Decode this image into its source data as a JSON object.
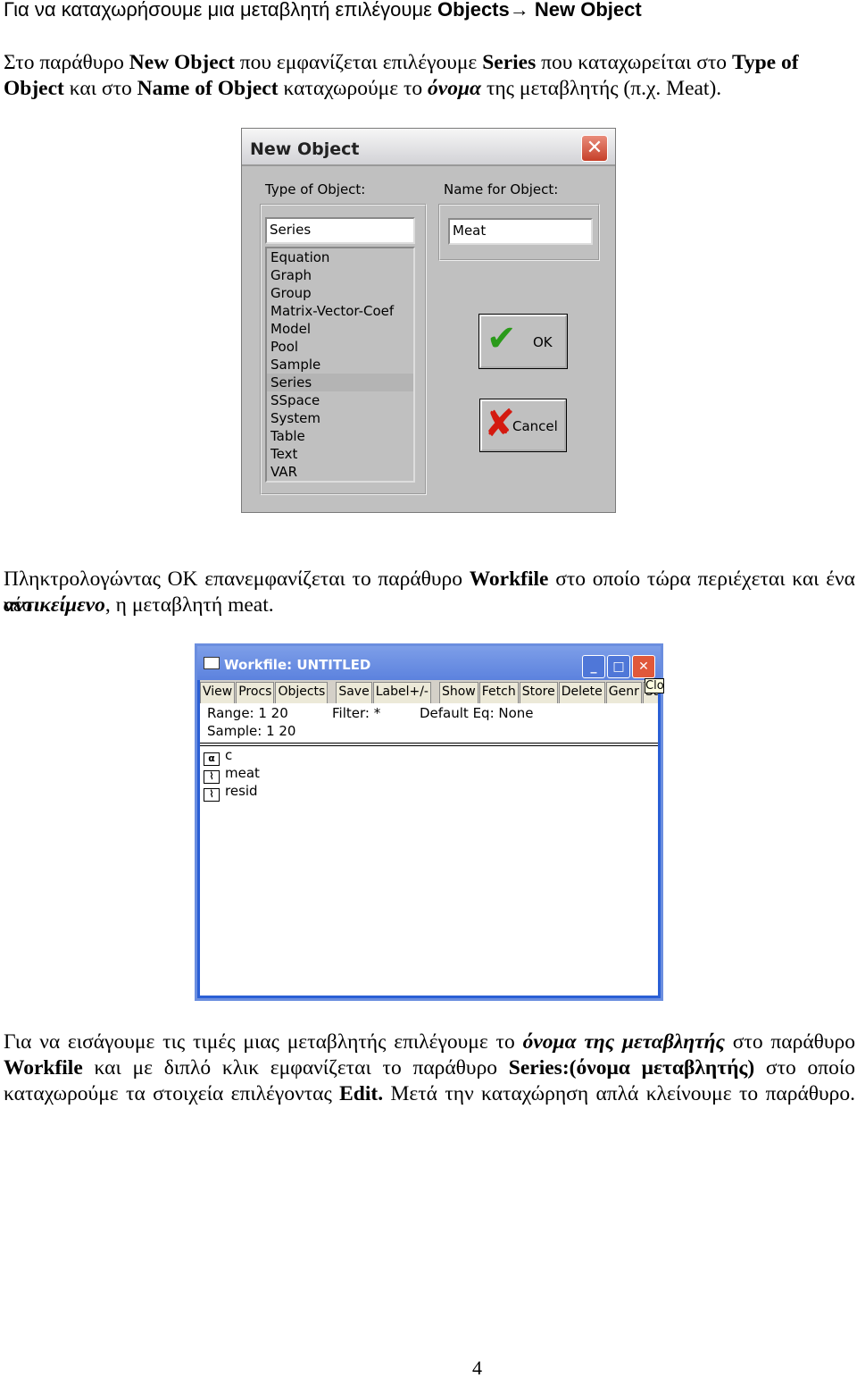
{
  "para1": {
    "text": "Για να καταχωρήσουμε μια μεταβλητή επιλέγουμε ",
    "b1": "Objects",
    "arrow": "→ ",
    "b2": "New Object"
  },
  "para2": {
    "t1": "Στο παράθυρο ",
    "b1": "New Object",
    "t2": " που εμφανίζεται επιλέγουμε ",
    "b2": "Series",
    "t3": " που καταχωρείται στο ",
    "b3": "Type of Object",
    "t4": " και στο ",
    "b4": "Name of Object",
    "t5": " καταχωρούμε το ",
    "bi1": "όνομα",
    "t6": " της μεταβλητής (π.χ. Meat)."
  },
  "dialog": {
    "title": "New Object",
    "type_label": "Type of Object:",
    "name_label": "Name for Object:",
    "type_value": "Series",
    "name_value": "Meat",
    "items": [
      "Equation",
      "Graph",
      "Group",
      "Matrix-Vector-Coef",
      "Model",
      "Pool",
      "Sample",
      "Series",
      "SSpace",
      "System",
      "Table",
      "Text",
      "VAR"
    ],
    "selected": "Series",
    "ok": "OK",
    "cancel": "Cancel"
  },
  "para3": {
    "t1": "Πληκτρολογώντας OK επανεμφανίζεται το παράθυρο ",
    "b1": "Workfile",
    "t2": " στο οποίο τώρα περιέχεται και ένα νέο ",
    "bi1": "αντικείμενο",
    "t3": ", η μεταβλητή meat."
  },
  "workfile": {
    "title": "Workfile: UNTITLED",
    "toolbar": [
      "View",
      "Procs",
      "Objects",
      "Save",
      "Label+/-",
      "Show",
      "Fetch",
      "Store",
      "Delete",
      "Genr",
      "Sample"
    ],
    "tooltip": "Close",
    "range": "Range:   1 20",
    "filter": "Filter: *",
    "default_eq": "Default Eq: None",
    "sample": "Sample: 1 20",
    "objects": [
      {
        "icon": "coef-icon",
        "name": "c"
      },
      {
        "icon": "series-icon",
        "name": "meat"
      },
      {
        "icon": "series-icon",
        "name": "resid"
      }
    ]
  },
  "para4": {
    "t1": "Για να εισάγουμε τις τιμές μιας μεταβλητής επιλέγουμε το ",
    "bi1": "όνομα της μεταβλητής",
    "t2": " στο παράθυρο ",
    "b1": "Workfile",
    "t3": " και με διπλό κλικ εμφανίζεται το παράθυρο ",
    "b2": "Series:(όνομα μεταβλητής)",
    "t4": " στο οποίο καταχωρούμε τα στοιχεία επιλέγοντας ",
    "b3": "Edit.",
    "t5": " Μετά την καταχώρηση απλά κλείνουμε το παράθυρο."
  },
  "page_number": "4"
}
